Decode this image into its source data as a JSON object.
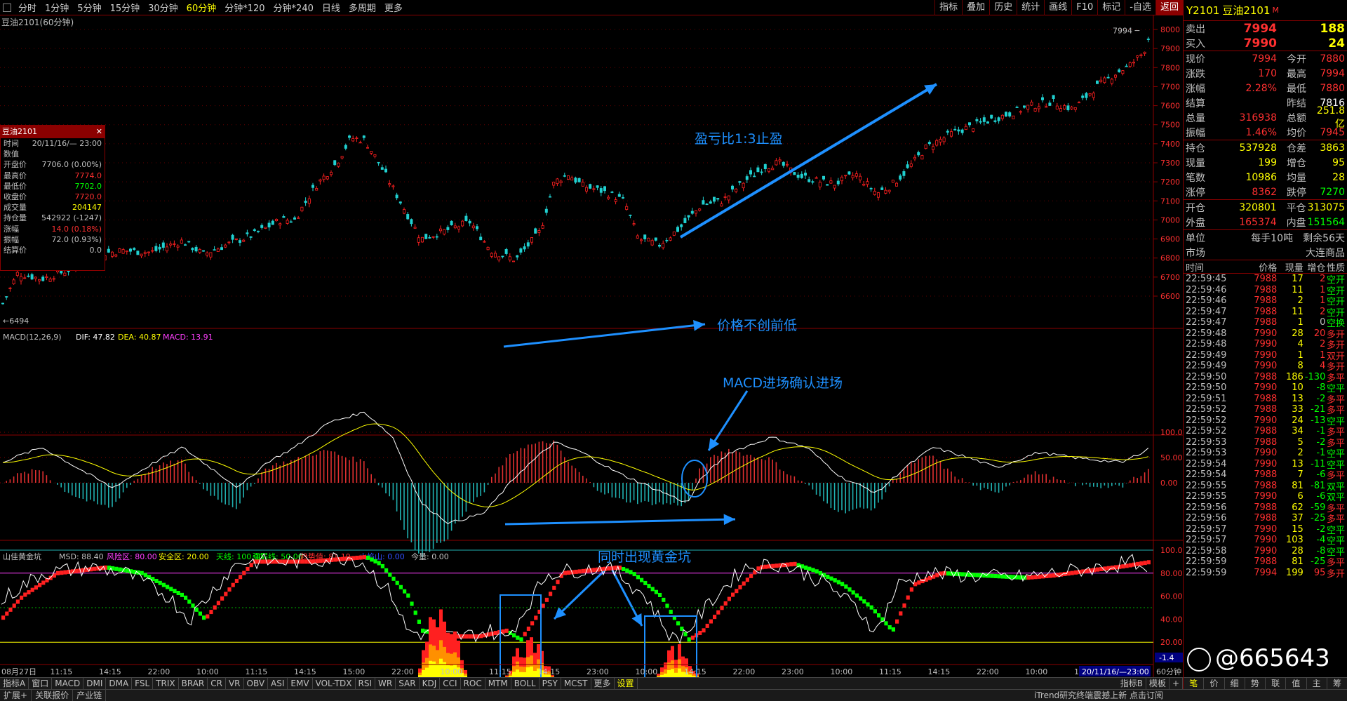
{
  "periodbar": {
    "items": [
      "分时",
      "1分钟",
      "5分钟",
      "15分钟",
      "30分钟",
      "60分钟",
      "分钟*120",
      "分钟*240",
      "日线",
      "多周期",
      "更多"
    ],
    "active": "60分钟",
    "tools": [
      "指标",
      "叠加",
      "历史",
      "统计",
      "画线",
      "F10",
      "标记",
      "-自选",
      "返回"
    ]
  },
  "chart": {
    "title": "豆油2101(60分钟)",
    "last_label": "7994",
    "low_label": "6494",
    "price_axis": [
      "8000",
      "7900",
      "7800",
      "7700",
      "7600",
      "7500",
      "7400",
      "7300",
      "7200",
      "7100",
      "7000",
      "6900",
      "6800",
      "6700",
      "6600"
    ],
    "annotations": {
      "a1": "盈亏比1:3止盈",
      "a2": "价格不创前低",
      "a3": "MACD进场确认进场",
      "a4": "同时出现黄金坑"
    },
    "macd_header": {
      "name": "MACD(12,26,9)",
      "dif": "DIF: 47.82",
      "dea": "DEA: 40.87",
      "macd": "MACD: 13.91"
    },
    "macd_axis": [
      "100.0",
      "50.00",
      "0.00"
    ],
    "ind_header": {
      "name": "山佳黄金坑",
      "msd": "MSD: 88.40",
      "risk": "风险区: 80.00",
      "safe": "安全区: 20.00",
      "sky": "天线: 100.00",
      "strong": "强弱线: 50.00",
      "trend": "趋势值: 81.19",
      "fire": "火焰山: 0.00",
      "vol": "今量: 0.00"
    },
    "ind_axis": [
      "100.0",
      "80.00",
      "60.00",
      "40.00",
      "20.00"
    ],
    "ind_label": "-1.4",
    "time_axis": [
      "08月27日",
      "11:15",
      "14:15",
      "22:00",
      "10:00",
      "11:15",
      "14:15",
      "15:00",
      "22:00",
      "10:00",
      "11:15",
      "14:15",
      "23:00",
      "10:00",
      "14:15",
      "22:00",
      "23:00",
      "10:00",
      "11:15",
      "14:15",
      "22:00",
      "10:00",
      "11:15"
    ],
    "time_end": "20/11/16/—23:00",
    "time_period": "60分钟"
  },
  "info": {
    "title": "豆油2101",
    "rows": [
      [
        "时间",
        "20/11/16/— 23:00"
      ],
      [
        "数值",
        ""
      ],
      [
        "开盘价",
        "7706.0 (0.00%)"
      ],
      [
        "最高价",
        "7774.0"
      ],
      [
        "最低价",
        "7702.0"
      ],
      [
        "收盘价",
        "7720.0"
      ],
      [
        "成交量",
        "204147"
      ],
      [
        "持仓量",
        "542922 (-1247)"
      ],
      [
        "涨幅",
        "14.0 (0.18%)"
      ],
      [
        "振幅",
        "72.0 (0.93%)"
      ],
      [
        "结算价",
        "0.0"
      ]
    ]
  },
  "tabs1": [
    "指标A",
    "窗口",
    "MACD",
    "DMI",
    "DMA",
    "FSL",
    "TRIX",
    "BRAR",
    "CR",
    "VR",
    "OBV",
    "ASI",
    "EMV",
    "VOL-TDX",
    "RSI",
    "WR",
    "SAR",
    "KDJ",
    "CCI",
    "ROC",
    "MTM",
    "BOLL",
    "PSY",
    "MCST",
    "更多",
    "设置"
  ],
  "tabs1_right": [
    "指标B",
    "模板",
    "+"
  ],
  "tabs2": [
    "扩展+",
    "关联报价",
    "产业链"
  ],
  "status": "iTrend研究终端震撼上新 点击订阅",
  "right": {
    "code": "Y2101",
    "name": "豆油2101",
    "m": "M",
    "sell_label": "卖出",
    "sell_price": "7994",
    "sell_vol": "188",
    "buy_label": "买入",
    "buy_price": "7990",
    "buy_vol": "24",
    "stats": [
      [
        "现价",
        "7994",
        "今开",
        "7880"
      ],
      [
        "涨跌",
        "170",
        "最高",
        "7994"
      ],
      [
        "涨幅",
        "2.28%",
        "最低",
        "7880"
      ],
      [
        "结算",
        "",
        "昨结",
        "7816"
      ],
      [
        "总量",
        "316938",
        "总额",
        "251.8亿"
      ],
      [
        "振幅",
        "1.46%",
        "均价",
        "7945"
      ]
    ],
    "stats2": [
      [
        "持仓",
        "537928",
        "仓差",
        "3863"
      ],
      [
        "现量",
        "199",
        "增仓",
        "95"
      ],
      [
        "笔数",
        "10986",
        "均量",
        "28"
      ],
      [
        "涨停",
        "8362",
        "跌停",
        "7270"
      ]
    ],
    "stats3": [
      [
        "开仓",
        "320801",
        "平仓",
        "313075"
      ],
      [
        "外盘",
        "165374",
        "内盘",
        "151564"
      ]
    ],
    "unit": [
      "单位",
      "每手10吨",
      "剩余56天"
    ],
    "market": [
      "市场",
      "大连商品"
    ],
    "tick_head": [
      "时间",
      "价格",
      "现量",
      "增仓",
      "性质"
    ],
    "ticks": [
      [
        "22:59:45",
        "7988",
        "17",
        "2",
        "空开"
      ],
      [
        "22:59:46",
        "7988",
        "11",
        "1",
        "空开"
      ],
      [
        "22:59:46",
        "7988",
        "2",
        "1",
        "空开"
      ],
      [
        "22:59:47",
        "7988",
        "11",
        "2",
        "空开"
      ],
      [
        "22:59:47",
        "7988",
        "1",
        "0",
        "空换"
      ],
      [
        "22:59:48",
        "7990",
        "28",
        "20",
        "多开"
      ],
      [
        "22:59:48",
        "7990",
        "4",
        "2",
        "多开"
      ],
      [
        "22:59:49",
        "7990",
        "1",
        "1",
        "双开"
      ],
      [
        "22:59:49",
        "7990",
        "8",
        "4",
        "多开"
      ],
      [
        "22:59:50",
        "7988",
        "186",
        "-130",
        "多平"
      ],
      [
        "22:59:50",
        "7990",
        "10",
        "-8",
        "空平"
      ],
      [
        "22:59:51",
        "7988",
        "13",
        "-2",
        "多平"
      ],
      [
        "22:59:52",
        "7988",
        "33",
        "-21",
        "多平"
      ],
      [
        "22:59:52",
        "7990",
        "24",
        "-13",
        "空平"
      ],
      [
        "22:59:52",
        "7988",
        "34",
        "-1",
        "多平"
      ],
      [
        "22:59:53",
        "7988",
        "5",
        "-2",
        "多平"
      ],
      [
        "22:59:53",
        "7990",
        "2",
        "-1",
        "空平"
      ],
      [
        "22:59:54",
        "7990",
        "13",
        "-11",
        "空平"
      ],
      [
        "22:59:54",
        "7988",
        "7",
        "-6",
        "多平"
      ],
      [
        "22:59:55",
        "7988",
        "81",
        "-81",
        "双平"
      ],
      [
        "22:59:55",
        "7990",
        "6",
        "-6",
        "双平"
      ],
      [
        "22:59:56",
        "7988",
        "62",
        "-59",
        "多平"
      ],
      [
        "22:59:56",
        "7988",
        "37",
        "-25",
        "多平"
      ],
      [
        "22:59:57",
        "7990",
        "15",
        "-2",
        "空平"
      ],
      [
        "22:59:57",
        "7990",
        "103",
        "-4",
        "空平"
      ],
      [
        "22:59:58",
        "7990",
        "28",
        "-8",
        "空平"
      ],
      [
        "22:59:59",
        "7988",
        "81",
        "-25",
        "多平"
      ],
      [
        "22:59:59",
        "7994",
        "199",
        "95",
        "多开"
      ]
    ],
    "bottom": [
      "笔",
      "价",
      "细",
      "势",
      "联",
      "值",
      "主",
      "筹"
    ]
  },
  "watermark": "@665643",
  "colors": {
    "up": "#ff2020",
    "down": "#20d0d0",
    "yellow": "#ffff00",
    "red": "#ff3030",
    "green": "#00ff00",
    "blue": "#1e90ff"
  }
}
